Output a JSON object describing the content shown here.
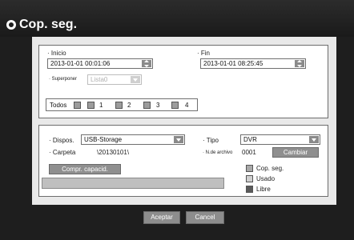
{
  "window": {
    "title": "Cop. seg."
  },
  "time": {
    "start_label": "· Inicio",
    "start_value": "2013-01-01 00:01:06",
    "end_label": "· Fin",
    "end_value": "2013-01-01 08:25:45",
    "overlap_label": "· Superponer",
    "overlap_value": "Lista0"
  },
  "channels": {
    "all_label": "Todos",
    "items": [
      "1",
      "2",
      "3",
      "4"
    ]
  },
  "device": {
    "label": "· Dispos.",
    "value": "USB-Storage",
    "type_label": "· Tipo",
    "type_value": "DVR",
    "folder_label": "· Carpeta",
    "folder_value": "\\20130101\\",
    "file_no_label": "· N.de archivo",
    "file_no_value": "0001",
    "change_button": "Cambiar",
    "check_capacity_button": "Compr. capacid."
  },
  "legend": {
    "items": [
      {
        "label": "Cop. seg.",
        "color": "#a9a9a9"
      },
      {
        "label": "Usado",
        "color": "#d0d0d0"
      },
      {
        "label": "Libre",
        "color": "#5a5a5a"
      }
    ]
  },
  "buttons": {
    "accept": "Aceptar",
    "cancel": "Cancel"
  }
}
